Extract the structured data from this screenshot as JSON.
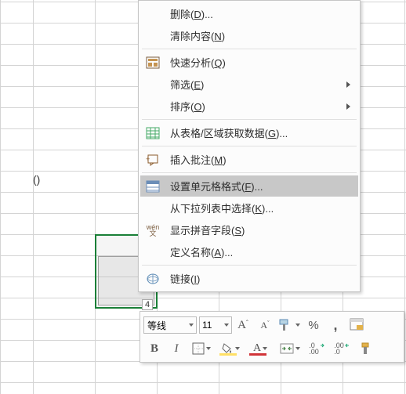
{
  "cells": {
    "parens": "()"
  },
  "selection": {
    "label": "4"
  },
  "menu": {
    "delete": "删除(<u>D</u>)...",
    "clear": "清除内容(<u>N</u>)",
    "quick": "快速分析(<u>Q</u>)",
    "filter": "筛选(<u>E</u>)",
    "sort": "排序(<u>O</u>)",
    "from_range": "从表格/区域获取数据(<u>G</u>)...",
    "insert_comment": "插入批注(<u>M</u>)",
    "format_cells": "设置单元格格式(<u>F</u>)...",
    "pick_list": "从下拉列表中选择(<u>K</u>)...",
    "phonetic": "显示拼音字段(<u>S</u>)",
    "define_name": "定义名称(<u>A</u>)...",
    "link": "链接(<u>I</u>)"
  },
  "toolbar": {
    "font_name": "等线",
    "font_size": "11",
    "font_grow": "A",
    "font_shrink": "A",
    "percent": "%",
    "comma": ",",
    "bold": "B",
    "italic": "I",
    "font_color_letter": "A",
    "decimals_inc": ".0",
    "decimals_dec": ".00"
  },
  "colors": {
    "font_color": "#d13438",
    "fill_color": "#ffe066"
  }
}
